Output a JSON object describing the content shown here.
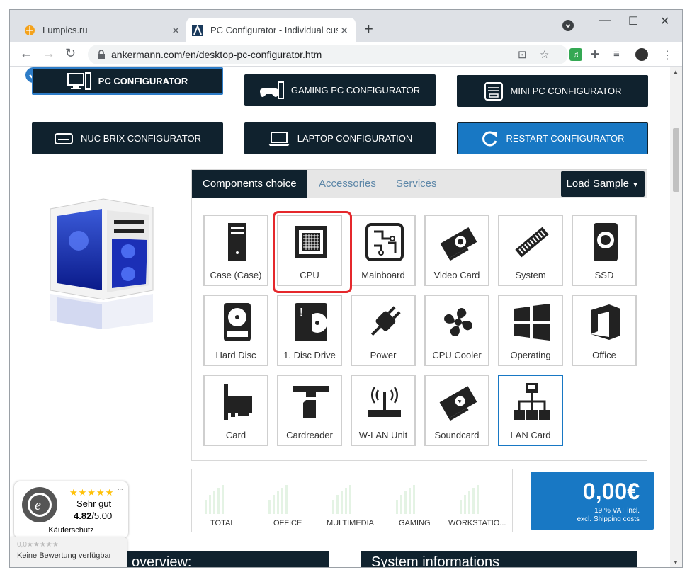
{
  "browser": {
    "tabs": [
      {
        "title": "Lumpics.ru",
        "active": false
      },
      {
        "title": "PC Configurator - Individual custo",
        "active": true
      }
    ],
    "url": "ankermann.com/en/desktop-pc-configurator.htm"
  },
  "configurators": [
    {
      "label": "PC CONFIGURATOR",
      "icon": "pc-icon"
    },
    {
      "label": "GAMING PC CONFIGURATOR",
      "icon": "gamepad-icon"
    },
    {
      "label": "MINI PC CONFIGURATOR",
      "icon": "mini-pc-icon"
    },
    {
      "label": "NUC BRIX CONFIGURATOR",
      "icon": "nuc-icon"
    },
    {
      "label": "LAPTOP CONFIGURATION",
      "icon": "laptop-icon"
    },
    {
      "label": "RESTART CONFIGURATOR",
      "icon": "restart-icon"
    }
  ],
  "panel": {
    "tabs": [
      "Components choice",
      "Accessories",
      "Services"
    ],
    "load_sample": "Load Sample",
    "components": [
      "Case (Case)",
      "CPU",
      "Mainboard",
      "Video Card",
      "System",
      "SSD",
      "Hard Disc",
      "1. Disc Drive",
      "Power",
      "CPU Cooler",
      "Operating",
      "Office",
      "Card",
      "Cardreader",
      "W-LAN Unit",
      "Soundcard",
      "LAN Card"
    ]
  },
  "benchmark": {
    "labels": [
      "TOTAL",
      "OFFICE",
      "MULTIMEDIA",
      "GAMING",
      "WORKSTATIO..."
    ]
  },
  "price": {
    "amount": "0,00€",
    "vat": "19 % VAT incl.",
    "shipping": "excl. Shipping costs"
  },
  "sections": {
    "overview": "overview:",
    "system_info": "System informations"
  },
  "trusted_shops": {
    "stars": "★★★★★",
    "rating_text": "Sehr gut",
    "score": "4.82",
    "score_max": "/5.00",
    "label": "Käuferschutz",
    "more": "...",
    "no_rating_score": "0,0",
    "no_rating_stars": "★★★★★",
    "no_rating": "Keine Bewertung verfügbar"
  },
  "colors": {
    "dark": "#10222e",
    "blue": "#1878c4",
    "highlight": "#e5282c"
  }
}
